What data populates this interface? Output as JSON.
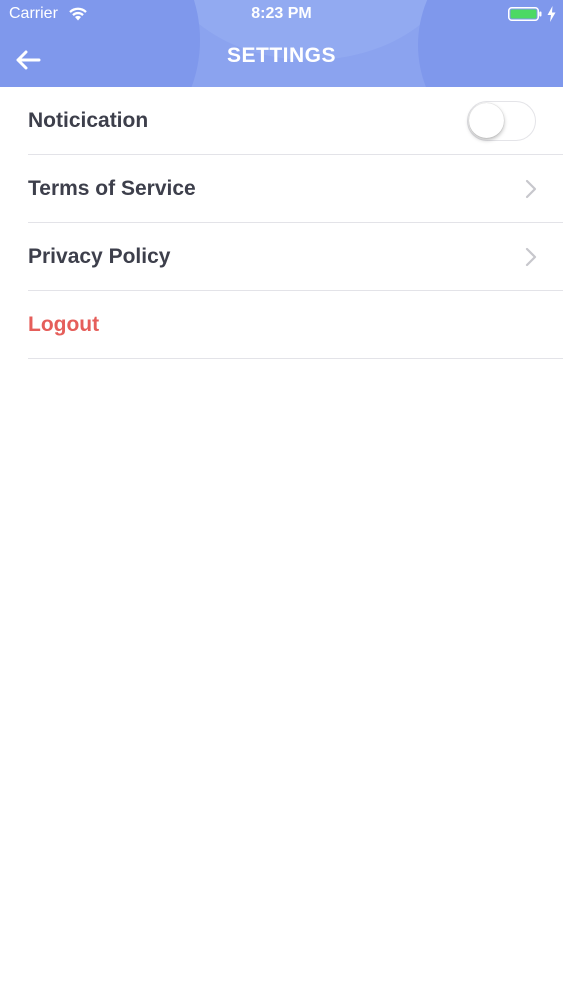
{
  "status_bar": {
    "carrier": "Carrier",
    "time": "8:23 PM",
    "battery_color": "#4cd964"
  },
  "header": {
    "title": "SETTINGS",
    "back_icon": "arrow-left-icon",
    "background_color": "#8ba3ef"
  },
  "settings": {
    "items": [
      {
        "label": "Noticication",
        "control": "toggle",
        "toggle_on": false
      },
      {
        "label": "Terms of Service",
        "control": "chevron-right-icon"
      },
      {
        "label": "Privacy Policy",
        "control": "chevron-right-icon"
      },
      {
        "label": "Logout",
        "control": "none",
        "color": "#e55e5a"
      }
    ]
  }
}
